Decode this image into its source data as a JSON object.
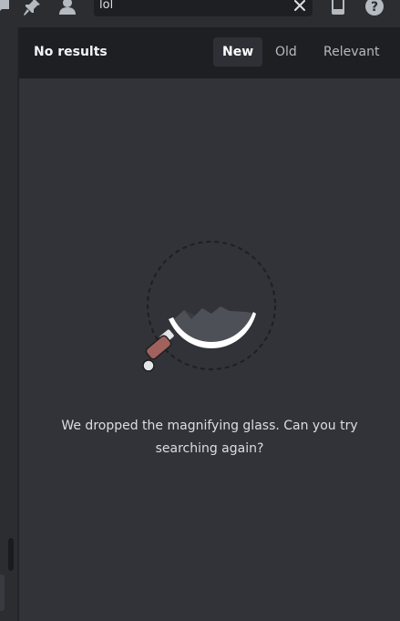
{
  "search": {
    "query": "lol"
  },
  "results_header": {
    "title": "No results",
    "sort_tabs": [
      {
        "label": "New",
        "active": true
      },
      {
        "label": "Old",
        "active": false
      },
      {
        "label": "Relevant",
        "active": false
      }
    ]
  },
  "empty_state": {
    "message": "We dropped the magnifying glass. Can you try searching again?"
  },
  "icons": {
    "toolbar": [
      "thread-icon",
      "pin-icon",
      "member-list-icon",
      "inbox-icon",
      "help-icon"
    ]
  },
  "colors": {
    "background": "#313338",
    "header": "#1e1f22",
    "text_primary": "#f2f3f5",
    "text_muted": "#b5bac1"
  }
}
